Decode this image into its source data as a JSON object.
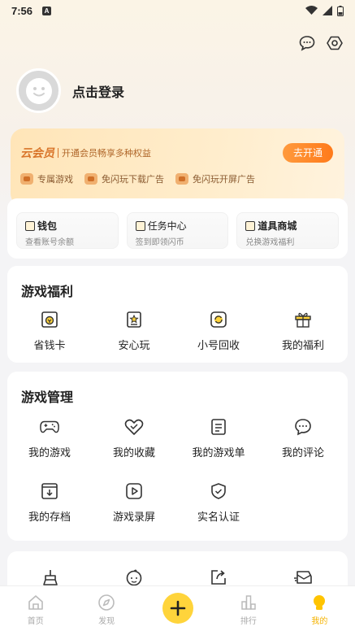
{
  "status": {
    "time": "7:56"
  },
  "profile": {
    "login_label": "点击登录"
  },
  "vip": {
    "name": "云会员",
    "desc": "开通会员畅享多种权益",
    "button": "去开通",
    "perks": [
      "专属游戏",
      "免闪玩下载广告",
      "免闪玩开屏广告"
    ]
  },
  "quick": [
    {
      "title": "钱包",
      "sub": "查看账号余额"
    },
    {
      "title": "任务中心",
      "sub": "签到即领闪币"
    },
    {
      "title": "道具商城",
      "sub": "兑换游戏福利"
    }
  ],
  "welfare": {
    "title": "游戏福利",
    "items": [
      "省钱卡",
      "安心玩",
      "小号回收",
      "我的福利"
    ]
  },
  "manage": {
    "title": "游戏管理",
    "items": [
      "我的游戏",
      "我的收藏",
      "我的游戏单",
      "我的评论",
      "我的存档",
      "游戏录屏",
      "实名认证"
    ]
  },
  "tabs": [
    "首页",
    "发现",
    "",
    "排行",
    "我的"
  ],
  "colors": {
    "accent": "#ffd43b",
    "vip_orange": "#ff7a1a",
    "active_tab": "#f5b300"
  }
}
